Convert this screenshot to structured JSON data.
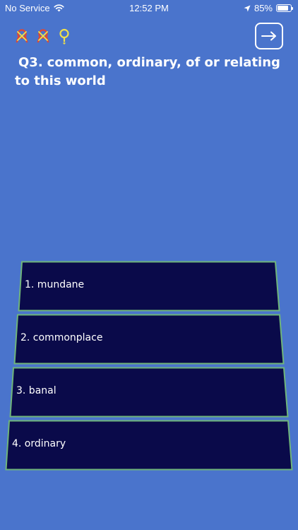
{
  "status_bar": {
    "carrier": "No Service",
    "time": "12:52 PM",
    "battery": "85%",
    "battery_level": 85
  },
  "progress": [
    {
      "icon": "wrong-answer-icon",
      "state": "wrong"
    },
    {
      "icon": "wrong-answer-icon",
      "state": "wrong"
    },
    {
      "icon": "current-question-icon",
      "state": "current"
    }
  ],
  "header": {
    "next_icon": "arrow-right-icon"
  },
  "question": {
    "number": "Q3.",
    "text": "common, ordinary, of or relating to this world"
  },
  "answers": [
    {
      "label": "1. mundane"
    },
    {
      "label": "2. commonplace"
    },
    {
      "label": "3. banal"
    },
    {
      "label": "4. ordinary"
    }
  ],
  "colors": {
    "background": "#4a74cc",
    "answer_fill": "#0a0a4a",
    "answer_border": "#6fb57a",
    "wrong_ring": "#d94a3a",
    "current_mark": "#f0e04a"
  }
}
